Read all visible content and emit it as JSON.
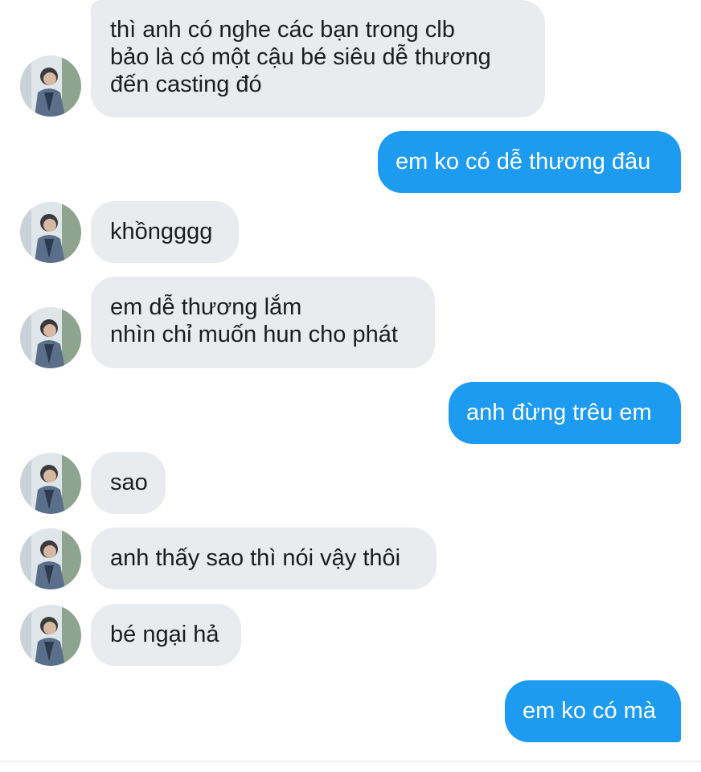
{
  "conversation": {
    "contact_avatar_icon": "user-photo-avatar",
    "colors": {
      "incoming_bubble": "#e9ebef",
      "outgoing_bubble": "#1d9bf0",
      "incoming_text": "#1d1d1f",
      "outgoing_text": "#ffffff"
    },
    "messages": [
      {
        "direction": "incoming",
        "text": "thì anh có nghe các bạn trong clb\nbảo là có một cậu bé siêu dễ thương\nđến casting đó"
      },
      {
        "direction": "outgoing",
        "text": "em ko có dễ thương đâu"
      },
      {
        "direction": "incoming",
        "text": "khồngggg"
      },
      {
        "direction": "incoming",
        "text": "em dễ thương lắm\nnhìn chỉ muốn hun cho phát"
      },
      {
        "direction": "outgoing",
        "text": "anh đừng trêu em"
      },
      {
        "direction": "incoming",
        "text": "sao"
      },
      {
        "direction": "incoming",
        "text": "anh thấy sao thì nói vậy thôi"
      },
      {
        "direction": "incoming",
        "text": "bé ngại hả"
      },
      {
        "direction": "outgoing",
        "text": "em ko có mà"
      }
    ]
  }
}
